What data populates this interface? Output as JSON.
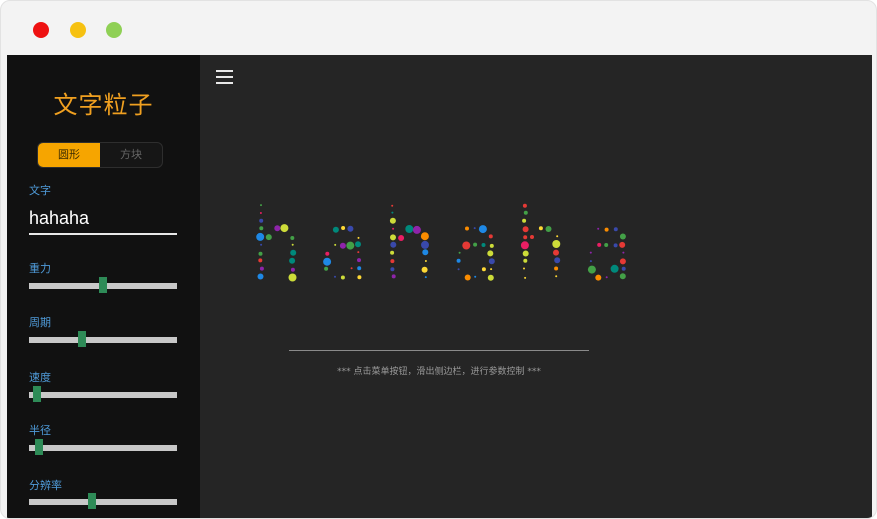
{
  "sidebar": {
    "title": "文字粒子",
    "shape_toggle": {
      "options": [
        "圆形",
        "方块"
      ],
      "selected": "圆形"
    },
    "text_field": {
      "label": "文字",
      "value": "hahaha"
    },
    "sliders": [
      {
        "label": "重力",
        "value": 0.5
      },
      {
        "label": "周期",
        "value": 0.35
      },
      {
        "label": "速度",
        "value": 0.03
      },
      {
        "label": "半径",
        "value": 0.04
      },
      {
        "label": "分辨率",
        "value": 0.42
      }
    ]
  },
  "main": {
    "menu_icon": "hamburger-menu-icon",
    "particle_text": "hahaha",
    "hint": "*** 点击菜单按钮，滑出侧边栏，进行参数控制 ***"
  },
  "colors": {
    "accent": "#f6a500",
    "title": "#f0a020",
    "label": "#4f9bd9",
    "slider_thumb": "#2e8b57",
    "particle_palette": [
      "#e53935",
      "#1e88e5",
      "#43a047",
      "#fdd835",
      "#8e24aa",
      "#fb8c00",
      "#00897b",
      "#3949ab",
      "#e91e63",
      "#cddc39"
    ]
  }
}
